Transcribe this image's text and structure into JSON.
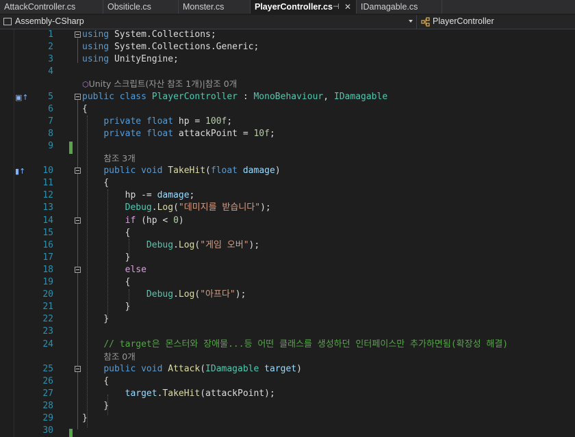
{
  "tabs": [
    {
      "label": "AttackController.cs"
    },
    {
      "label": "Obsiticle.cs"
    },
    {
      "label": "Monster.cs"
    },
    {
      "label": "PlayerController.cs",
      "active": true
    },
    {
      "label": "IDamagable.cs"
    }
  ],
  "nav": {
    "project": "Assembly-CSharp",
    "member": "PlayerController"
  },
  "lines": [
    {
      "n": "1",
      "tokens": [
        [
          "kw",
          "using"
        ],
        [
          "pl",
          " System.Collections;"
        ]
      ]
    },
    {
      "n": "2",
      "tokens": [
        [
          "kw",
          "using"
        ],
        [
          "pl",
          " System.Collections.Generic;"
        ]
      ]
    },
    {
      "n": "3",
      "tokens": [
        [
          "kw",
          "using"
        ],
        [
          "pl",
          " UnityEngine;"
        ]
      ]
    },
    {
      "n": "4",
      "tokens": []
    },
    {
      "lens": "Unity 스크립트(자산 참조 1개)|참조 0개"
    },
    {
      "n": "5",
      "tokens": [
        [
          "kw",
          "public"
        ],
        [
          "pl",
          " "
        ],
        [
          "kw",
          "class"
        ],
        [
          "pl",
          " "
        ],
        [
          "ty",
          "PlayerController"
        ],
        [
          "pl",
          " : "
        ],
        [
          "ty",
          "MonoBehaviour"
        ],
        [
          "pl",
          ", "
        ],
        [
          "ty",
          "IDamagable"
        ]
      ]
    },
    {
      "n": "6",
      "tokens": [
        [
          "pl",
          "{"
        ]
      ]
    },
    {
      "n": "7",
      "tokens": [
        [
          "pl",
          "    "
        ],
        [
          "kw",
          "private"
        ],
        [
          "pl",
          " "
        ],
        [
          "kw",
          "float"
        ],
        [
          "pl",
          " hp = "
        ],
        [
          "nm",
          "100f"
        ],
        [
          "pl",
          ";"
        ]
      ]
    },
    {
      "n": "8",
      "tokens": [
        [
          "pl",
          "    "
        ],
        [
          "kw",
          "private"
        ],
        [
          "pl",
          " "
        ],
        [
          "kw",
          "float"
        ],
        [
          "pl",
          " attackPoint = "
        ],
        [
          "nm",
          "10f"
        ],
        [
          "pl",
          ";"
        ]
      ]
    },
    {
      "n": "9",
      "tokens": []
    },
    {
      "lens": "참조 3개"
    },
    {
      "n": "10",
      "tokens": [
        [
          "pl",
          "    "
        ],
        [
          "kw",
          "public"
        ],
        [
          "pl",
          " "
        ],
        [
          "kw",
          "void"
        ],
        [
          "pl",
          " "
        ],
        [
          "fn",
          "TakeHit"
        ],
        [
          "pl",
          "("
        ],
        [
          "kw",
          "float"
        ],
        [
          "pl",
          " "
        ],
        [
          "pm",
          "damage"
        ],
        [
          "pl",
          ")"
        ]
      ]
    },
    {
      "n": "11",
      "tokens": [
        [
          "pl",
          "    {"
        ]
      ]
    },
    {
      "n": "12",
      "tokens": [
        [
          "pl",
          "        hp -= "
        ],
        [
          "pm",
          "damage"
        ],
        [
          "pl",
          ";"
        ]
      ]
    },
    {
      "n": "13",
      "tokens": [
        [
          "pl",
          "        "
        ],
        [
          "ty",
          "Debug"
        ],
        [
          "pl",
          "."
        ],
        [
          "fn",
          "Log"
        ],
        [
          "pl",
          "("
        ],
        [
          "st",
          "\"데미지를 받습니다\""
        ],
        [
          "pl",
          ");"
        ]
      ]
    },
    {
      "n": "14",
      "tokens": [
        [
          "pl",
          "        "
        ],
        [
          "ct",
          "if"
        ],
        [
          "pl",
          " (hp < "
        ],
        [
          "nm",
          "0"
        ],
        [
          "pl",
          ")"
        ]
      ]
    },
    {
      "n": "15",
      "tokens": [
        [
          "pl",
          "        {"
        ]
      ]
    },
    {
      "n": "16",
      "tokens": [
        [
          "pl",
          "            "
        ],
        [
          "ty",
          "Debug"
        ],
        [
          "pl",
          "."
        ],
        [
          "fn",
          "Log"
        ],
        [
          "pl",
          "("
        ],
        [
          "st",
          "\"게임 오버\""
        ],
        [
          "pl",
          ");"
        ]
      ]
    },
    {
      "n": "17",
      "tokens": [
        [
          "pl",
          "        }"
        ]
      ]
    },
    {
      "n": "18",
      "tokens": [
        [
          "pl",
          "        "
        ],
        [
          "ct",
          "else"
        ]
      ]
    },
    {
      "n": "19",
      "tokens": [
        [
          "pl",
          "        {"
        ]
      ]
    },
    {
      "n": "20",
      "tokens": [
        [
          "pl",
          "            "
        ],
        [
          "ty",
          "Debug"
        ],
        [
          "pl",
          "."
        ],
        [
          "fn",
          "Log"
        ],
        [
          "pl",
          "("
        ],
        [
          "st",
          "\"아프다\""
        ],
        [
          "pl",
          ");"
        ]
      ]
    },
    {
      "n": "21",
      "tokens": [
        [
          "pl",
          "        }"
        ]
      ]
    },
    {
      "n": "22",
      "tokens": [
        [
          "pl",
          "    }"
        ]
      ]
    },
    {
      "n": "23",
      "tokens": []
    },
    {
      "n": "24",
      "tokens": [
        [
          "pl",
          "    "
        ],
        [
          "cm",
          "// target은 몬스터와 장애물...등 어떤 클래스를 생성하던 인터페이스만 추가하면됨(확장성 해결)"
        ]
      ]
    },
    {
      "lens": "참조 0개"
    },
    {
      "n": "25",
      "tokens": [
        [
          "pl",
          "    "
        ],
        [
          "kw",
          "public"
        ],
        [
          "pl",
          " "
        ],
        [
          "kw",
          "void"
        ],
        [
          "pl",
          " "
        ],
        [
          "fn",
          "Attack"
        ],
        [
          "pl",
          "("
        ],
        [
          "ty",
          "IDamagable"
        ],
        [
          "pl",
          " "
        ],
        [
          "pm",
          "target"
        ],
        [
          "pl",
          ")"
        ]
      ]
    },
    {
      "n": "26",
      "tokens": [
        [
          "pl",
          "    {"
        ]
      ]
    },
    {
      "n": "27",
      "tokens": [
        [
          "pl",
          "        "
        ],
        [
          "pm",
          "target"
        ],
        [
          "pl",
          "."
        ],
        [
          "fn",
          "TakeHit"
        ],
        [
          "pl",
          "(attackPoint);"
        ]
      ]
    },
    {
      "n": "28",
      "tokens": [
        [
          "pl",
          "    }"
        ]
      ]
    },
    {
      "n": "29",
      "tokens": [
        [
          "pl",
          "}"
        ]
      ]
    },
    {
      "n": "30",
      "tokens": []
    }
  ]
}
